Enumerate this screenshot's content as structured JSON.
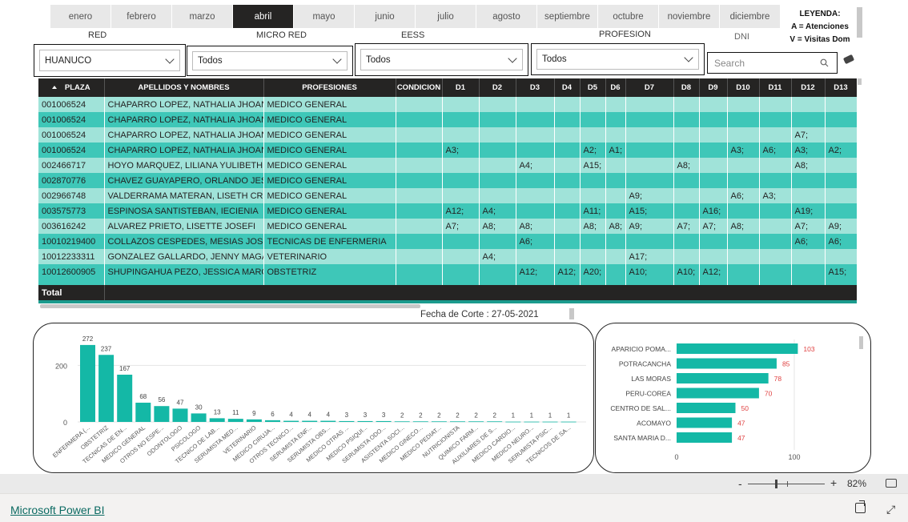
{
  "months": [
    "enero",
    "febrero",
    "marzo",
    "abril",
    "mayo",
    "junio",
    "julio",
    "agosto",
    "septiembre",
    "octubre",
    "noviembre",
    "diciembre"
  ],
  "selected_month": "abril",
  "legend": {
    "title": "LEYENDA:",
    "line1": "A = Atenciones",
    "line2": "V = Visitas Dom"
  },
  "filters": {
    "red": {
      "label": "RED",
      "value": "HUANUCO"
    },
    "micro_red": {
      "label": "MICRO RED",
      "value": "Todos"
    },
    "eess": {
      "label": "EESS",
      "value": "Todos"
    },
    "profesion": {
      "label": "PROFESION",
      "value": "Todos"
    },
    "dni": {
      "label": "DNI",
      "placeholder": "Search"
    }
  },
  "table": {
    "columns": [
      "PLAZA",
      "APELLIDOS Y NOMBRES",
      "PROFESIONES",
      "CONDICION",
      "D1",
      "D2",
      "D3",
      "D4",
      "D5",
      "D6",
      "D7",
      "D8",
      "D9",
      "D10",
      "D11",
      "D12",
      "D13"
    ],
    "rows": [
      [
        "001006524",
        "CHAPARRO LOPEZ, NATHALIA JHOAN",
        "MEDICO GENERAL",
        "",
        "",
        "",
        "",
        "",
        "",
        "",
        "",
        "",
        "",
        "",
        "",
        "",
        ""
      ],
      [
        "001006524",
        "CHAPARRO LOPEZ, NATHALIA JHOAN",
        "MEDICO GENERAL",
        "",
        "",
        "",
        "",
        "",
        "",
        "",
        "",
        "",
        "",
        "",
        "",
        "",
        ""
      ],
      [
        "001006524",
        "CHAPARRO LOPEZ, NATHALIA JHOAN",
        "MEDICO GENERAL",
        "",
        "",
        "",
        "",
        "",
        "",
        "",
        "",
        "",
        "",
        "",
        "",
        "A7;",
        ""
      ],
      [
        "001006524",
        "CHAPARRO LOPEZ, NATHALIA JHOAN",
        "MEDICO GENERAL",
        "",
        "A3;",
        "",
        "",
        "",
        "A2;",
        "A1;",
        "",
        "",
        "",
        "A3;",
        "A6;",
        "A3;",
        "A2;"
      ],
      [
        "002466717",
        "HOYO MARQUEZ, LILIANA YULIBETH",
        "MEDICO GENERAL",
        "",
        "",
        "",
        "A4;",
        "",
        "A15;",
        "",
        "",
        "A8;",
        "",
        "",
        "",
        "A8;",
        ""
      ],
      [
        "002870776",
        "CHAVEZ GUAYAPERO, ORLANDO JESU",
        "MEDICO GENERAL",
        "",
        "",
        "",
        "",
        "",
        "",
        "",
        "",
        "",
        "",
        "",
        "",
        "",
        ""
      ],
      [
        "002966748",
        "VALDERRAMA MATERAN, LISETH CRI",
        "MEDICO GENERAL",
        "",
        "",
        "",
        "",
        "",
        "",
        "",
        "A9;",
        "",
        "",
        "A6;",
        "A3;",
        "",
        ""
      ],
      [
        "003575773",
        "ESPINOSA SANTISTEBAN, IECIENIA",
        "MEDICO GENERAL",
        "",
        "A12;",
        "A4;",
        "",
        "",
        "A11;",
        "",
        "A15;",
        "",
        "A16;",
        "",
        "",
        "A19;",
        ""
      ],
      [
        "003616242",
        "ALVAREZ PRIETO, LISETTE JOSEFI",
        "MEDICO GENERAL",
        "",
        "A7;",
        "A8;",
        "A8;",
        "",
        "A8;",
        "A8;",
        "A9;",
        "A7;",
        "A7;",
        "A8;",
        "",
        "A7;",
        "A9;"
      ],
      [
        "10010219400",
        "COLLAZOS CESPEDES, MESIAS JOSU",
        "TECNICAS DE ENFERMERIA",
        "",
        "",
        "",
        "A6;",
        "",
        "",
        "",
        "",
        "",
        "",
        "",
        "",
        "A6;",
        "A6;"
      ],
      [
        "10012233311",
        "GONZALEZ GALLARDO, JENNY MAGAL",
        "VETERINARIO",
        "",
        "",
        "A4;",
        "",
        "",
        "",
        "",
        "A17;",
        "",
        "",
        "",
        "",
        "",
        ""
      ],
      [
        "10012600905",
        "SHUPINGAHUA PEZO, JESSICA MARG",
        "OBSTETRIZ",
        "",
        "",
        "",
        "A12;",
        "A12;",
        "A20;",
        "",
        "A10;",
        "A10;",
        "A12;",
        "",
        "",
        "",
        "A15;"
      ]
    ],
    "total_label": "Total"
  },
  "fecha_corte": "Fecha de Corte : 27-05-2021",
  "chart_data": [
    {
      "type": "bar",
      "categories": [
        "ENFERMERA (...",
        "OBSTETRIZ",
        "TECNICAS DE EN...",
        "MEDICO GENERAL",
        "OTROS NO ESPE...",
        "ODONTOLOGO",
        "PSICOLOGO",
        "TECNICO DE LAB...",
        "SERUMISTA MED...",
        "VETERINARIO",
        "MEDICO CIRUJA...",
        "OTROS TECNICO...",
        "SERUMISTA ENF...",
        "SERUMISTA OBS...",
        "MEDICO OTRAS ...",
        "MEDICO PSIQUI...",
        "SERUMISTA ODO...",
        "ASISTENTA SOCI...",
        "MEDICO GINECO...",
        "MEDICO PEDIAT...",
        "NUTRICIONISTA",
        "QUIMICO FARM...",
        "AUXILIARES DE S...",
        "MEDICO CARDIO...",
        "MEDICO NEURO...",
        "SERUMISTA PSIC...",
        "TECNICOS DE SA..."
      ],
      "values": [
        272,
        237,
        167,
        68,
        56,
        47,
        30,
        13,
        11,
        9,
        6,
        4,
        4,
        4,
        3,
        3,
        3,
        2,
        2,
        2,
        2,
        2,
        2,
        1,
        1,
        1,
        1
      ],
      "yticks": [
        0,
        200
      ],
      "ylim": [
        0,
        300
      ],
      "color": "#14b8a6"
    },
    {
      "type": "bar",
      "orientation": "horizontal",
      "categories": [
        "APARICIO POMA...",
        "POTRACANCHA",
        "LAS MORAS",
        "PERU-COREA",
        "CENTRO DE SAL...",
        "ACOMAYO",
        "SANTA MARIA D..."
      ],
      "values": [
        103,
        85,
        78,
        70,
        50,
        47,
        47
      ],
      "xticks": [
        0,
        100
      ],
      "xlim": [
        0,
        110
      ],
      "color": "#14b8a6",
      "label_color": "#e04343"
    }
  ],
  "zoom": {
    "minus": "-",
    "plus": "+",
    "level": "82%"
  },
  "footer": {
    "brand": "Microsoft Power BI"
  }
}
